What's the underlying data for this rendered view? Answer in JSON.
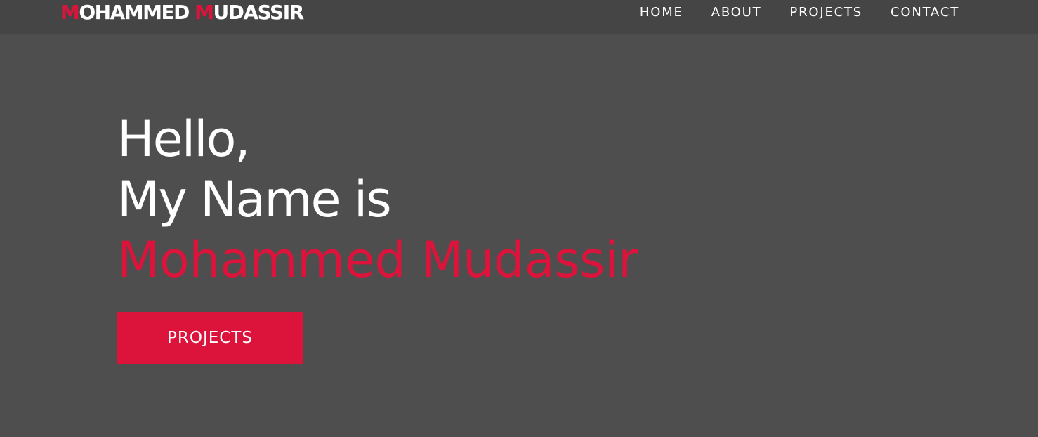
{
  "logo": {
    "first_initial": "M",
    "first_rest": "OHAMMED ",
    "last_initial": "M",
    "last_rest": "UDASSIR"
  },
  "nav": {
    "items": [
      {
        "label": "HOME"
      },
      {
        "label": "ABOUT"
      },
      {
        "label": "PROJECTS"
      },
      {
        "label": "CONTACT"
      }
    ]
  },
  "hero": {
    "greeting": "Hello,",
    "intro": "My Name is",
    "name": "Mohammed Mudassir",
    "cta_label": "PROJECTS"
  },
  "colors": {
    "accent": "#dc143c",
    "background": "#4e4e4e",
    "navbar": "#454545",
    "text": "#ffffff"
  }
}
